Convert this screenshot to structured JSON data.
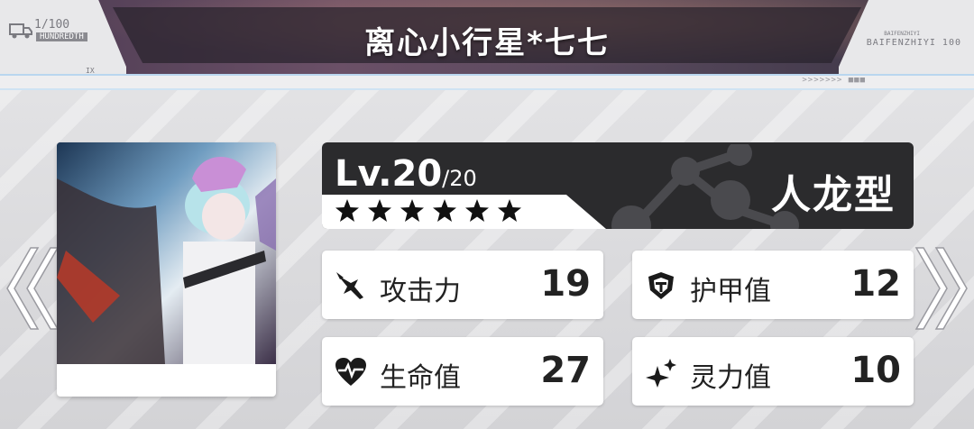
{
  "header": {
    "title": "离心小行星*七七",
    "counter": "1/100",
    "counter_sub": "HUNDREDTH",
    "left_code": "IX",
    "brand": "BAIFENZHIYI 100",
    "brand_small": "BAIFENZHIYI",
    "arrows_text": ">>>>>>> ■■■"
  },
  "character": {
    "level": "Lv.20",
    "level_max": "/20",
    "stars": 6,
    "type": "人龙型"
  },
  "stats": [
    {
      "label": "攻击力",
      "value": "19",
      "icon": "attack-icon"
    },
    {
      "label": "护甲值",
      "value": "12",
      "icon": "shield-icon"
    },
    {
      "label": "生命值",
      "value": "27",
      "icon": "heart-icon"
    },
    {
      "label": "灵力值",
      "value": "10",
      "icon": "sparkle-icon"
    }
  ],
  "colors": {
    "panel_dark": "#2b2b2d",
    "card": "#ffffff",
    "text": "#222222"
  }
}
